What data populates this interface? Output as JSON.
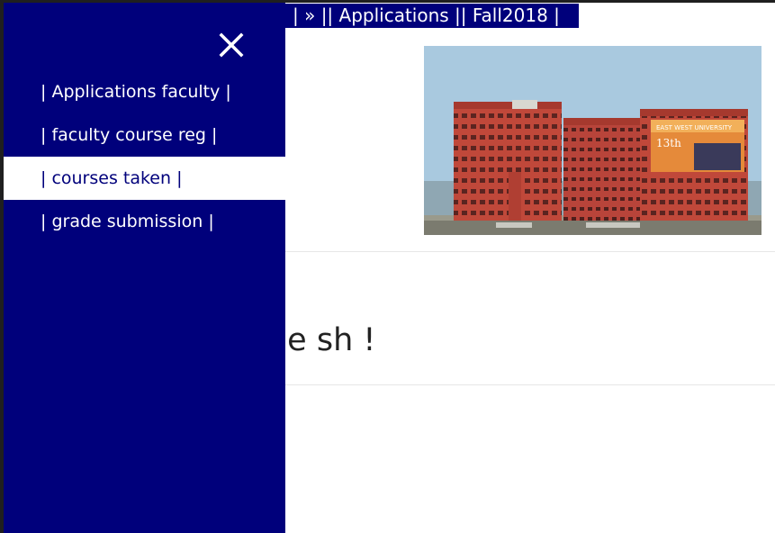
{
  "breadcrumb": {
    "text": "| » || Applications || Fall2018 |"
  },
  "sidebar": {
    "close_icon": "close-icon",
    "items": [
      {
        "label": "| Applications faculty |",
        "active": false
      },
      {
        "label": "| faculty course reg |",
        "active": false
      },
      {
        "label": "| courses taken |",
        "active": true
      },
      {
        "label": "| grade submission |",
        "active": false
      }
    ]
  },
  "main": {
    "greeting": "ne sh !",
    "photo": "campus-building-photo",
    "banner_text": "EAST WEST UNIVERSITY"
  },
  "colors": {
    "sidebar_bg": "#00007b",
    "active_item_bg": "#ffffff",
    "active_item_text": "#00007b"
  }
}
